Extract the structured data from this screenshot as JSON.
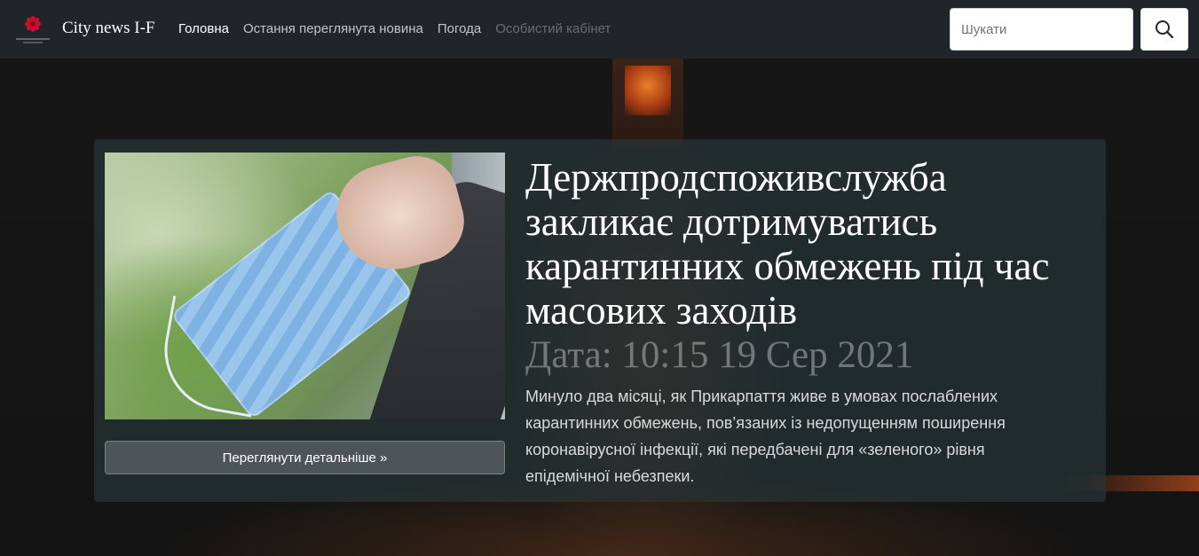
{
  "navbar": {
    "brand": "City news I-F",
    "nav_items": [
      {
        "label": "Головна",
        "state": "active"
      },
      {
        "label": "Остання переглянута новина",
        "state": "normal"
      },
      {
        "label": "Погода",
        "state": "normal"
      },
      {
        "label": "Особистий кабінет",
        "state": "disabled"
      }
    ],
    "search": {
      "placeholder": "Шукати",
      "value": ""
    },
    "search_icon": "search-icon",
    "logo_icon": "flower-logo-icon"
  },
  "article": {
    "headline": "Держпродспоживслужба закликає дотримуватись карантинних обмежень під час масових заходів",
    "date": "Дата: 10:15 19 Сер 2021",
    "summary": "Минуло два місяці, як Прикарпаття живе в умовах послаблених карантинних обмежень, пов’язаних із недопущенням поширення коронавірусної інфекції, які передбачені для «зеленого» рівня епідемічної небезпеки.",
    "details_button": "Переглянути детальніше »"
  },
  "colors": {
    "navbar_bg": "#212529",
    "accent_logo": "#c8102e"
  }
}
